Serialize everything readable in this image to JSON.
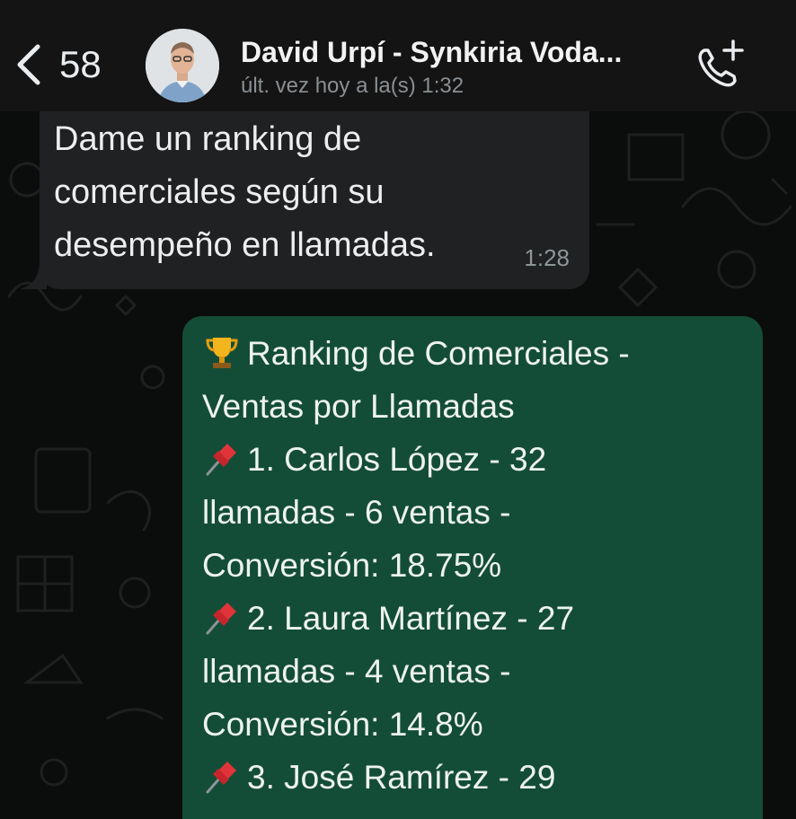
{
  "header": {
    "unread_count": "58",
    "contact_name": "David Urpí - Synkiria Voda...",
    "status": "últ. vez hoy a la(s) 1:32"
  },
  "messages": {
    "incoming": {
      "text": "Dame un ranking de comerciales según su desempeño en llamadas.",
      "time": "1:28"
    },
    "outgoing": {
      "lines": [
        "Ranking de Comerciales -",
        "Ventas por Llamadas",
        "1. Carlos López - 32",
        "llamadas - 6 ventas -",
        "Conversión: 18.75%",
        "2. Laura Martínez - 27",
        "llamadas - 4 ventas -",
        "Conversión: 14.8%",
        "3. José Ramírez - 29"
      ]
    }
  },
  "icons": {
    "back": "chevron-left-icon",
    "call": "phone-plus-icon",
    "trophy": "trophy-icon",
    "pin": "pushpin-icon"
  },
  "colors": {
    "header_bg": "#141414",
    "chat_bg": "#0b0c0c",
    "incoming_bubble": "#1f2122",
    "outgoing_bubble": "#144d37",
    "muted_text": "#8a8f93"
  }
}
